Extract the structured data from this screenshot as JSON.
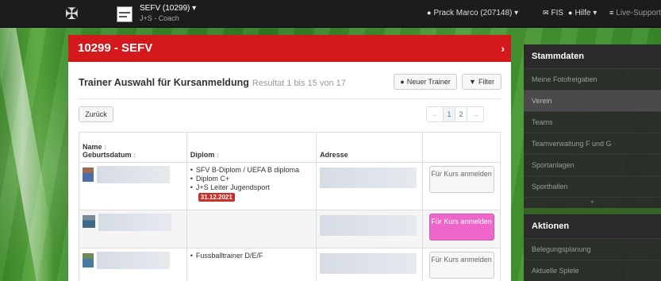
{
  "navbar": {
    "club_title": "SEFV (10299) ▾",
    "club_sub": "J+S - Coach",
    "user": "Prack Marco (207148) ▾",
    "fis": "FIS",
    "help": "Hilfe ▾",
    "support": "Live-Support"
  },
  "panel": {
    "title": "10299 - SEFV",
    "section_title": "Trainer Auswahl für Kursanmeldung",
    "result": "Resultat 1 bis 15 von 17",
    "btn_new_trainer": "Neuer Trainer",
    "btn_filter": "Filter",
    "btn_back": "Zurück",
    "pager": [
      "←",
      "1",
      "2",
      "→"
    ]
  },
  "table": {
    "headers": {
      "name": "Name",
      "birth": "Geburtsdatum",
      "diploma": "Diplom",
      "address": "Adresse"
    },
    "rows": [
      {
        "diplomas": [
          "SFV B-Diplom / UEFA B diploma",
          "Diplom C+",
          "J+S Leiter Jugendsport"
        ],
        "badge": "31.12.2021",
        "action": "Für Kurs anmelden"
      },
      {
        "diplomas": [],
        "action": "Für Kurs anmelden"
      },
      {
        "diplomas": [
          "Fussballtrainer D/E/F"
        ],
        "action": "Für Kurs anmelden"
      }
    ]
  },
  "sidebar": {
    "stammdaten_title": "Stammdaten",
    "stammdaten_items": [
      "Meine Fotofreigaben",
      "Verein",
      "Teams",
      "Teamverwaltung F und G",
      "Sportanlagen",
      "Sporthallen"
    ],
    "more": "▾",
    "aktionen_title": "Aktionen",
    "aktionen_items": [
      "Belegungsplanung",
      "Aktuelle Spiele"
    ]
  }
}
